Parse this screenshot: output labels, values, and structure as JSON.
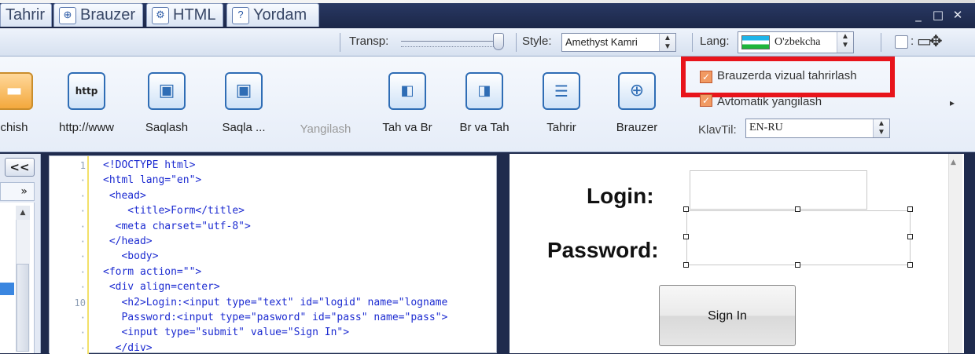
{
  "window": {
    "controls": [
      "_",
      "□",
      "✕"
    ]
  },
  "tabs": [
    {
      "label": "Tahrir",
      "icon": "none"
    },
    {
      "label": "Brauzer",
      "icon": "globe-icon"
    },
    {
      "label": "HTML",
      "icon": "html-gear-icon"
    },
    {
      "label": "Yordam",
      "icon": "help-icon"
    }
  ],
  "settings": {
    "transp_label": "Transp:",
    "style_label": "Style:",
    "style_value": "Amethyst Kamri",
    "lang_label": "Lang:",
    "lang_value": "O'zbekcha",
    "lang_flag_colors": [
      "#1eb5e9",
      "#ffffff",
      "#1eb53a"
    ],
    "extra_sep": ":"
  },
  "ribbon": {
    "buttons": [
      {
        "label": "chish",
        "icon": "folder-icon",
        "enabled": true
      },
      {
        "label": "http://www",
        "icon": "http-icon",
        "enabled": true
      },
      {
        "label": "Saqlash",
        "icon": "save-icon",
        "enabled": true
      },
      {
        "label": "Saqla ...",
        "icon": "save-as-icon",
        "enabled": true
      },
      {
        "label": "Yangilash",
        "icon": "none",
        "enabled": false
      },
      {
        "label": "Tah va Br",
        "icon": "split-icon",
        "enabled": true
      },
      {
        "label": "Br va Tah",
        "icon": "split-browser-icon",
        "enabled": true
      },
      {
        "label": "Tahrir",
        "icon": "edit-page-icon",
        "enabled": true
      },
      {
        "label": "Brauzer",
        "icon": "globe-icon",
        "enabled": true
      }
    ],
    "options": {
      "visual_edit": {
        "label": "Brauzerda vizual tahrirlash",
        "checked": true
      },
      "auto_refresh": {
        "label": "Avtomatik yangilash",
        "checked": true
      }
    },
    "klavtil_label": "KlavTil:",
    "klavtil_value": "EN-RU",
    "highlight_color": "#e8141b"
  },
  "leftpanel": {
    "collapse_label": "<<",
    "expand_label": "»"
  },
  "editor": {
    "line_numbers": [
      {
        "label": "1",
        "row": 0
      },
      {
        "label": "10",
        "row": 9
      }
    ],
    "lines": [
      "<!DOCTYPE html>",
      "<html lang=\"en\">",
      " <head>",
      "    <title>Form</title>",
      "  <meta charset=\"utf-8\">",
      " </head>",
      "   <body>",
      "<form action=\"\">",
      " <div align=center>",
      "   <h2>Login:<input type=\"text\" id=\"logid\" name=\"logname",
      "   Password:<input type=\"pasword\" id=\"pass\" name=\"pass\">",
      "   <input type=\"submit\" value=\"Sign In\">",
      "  </div>"
    ]
  },
  "preview": {
    "login_label": "Login:",
    "password_label": "Password:",
    "sign_in_label": "Sign In"
  }
}
